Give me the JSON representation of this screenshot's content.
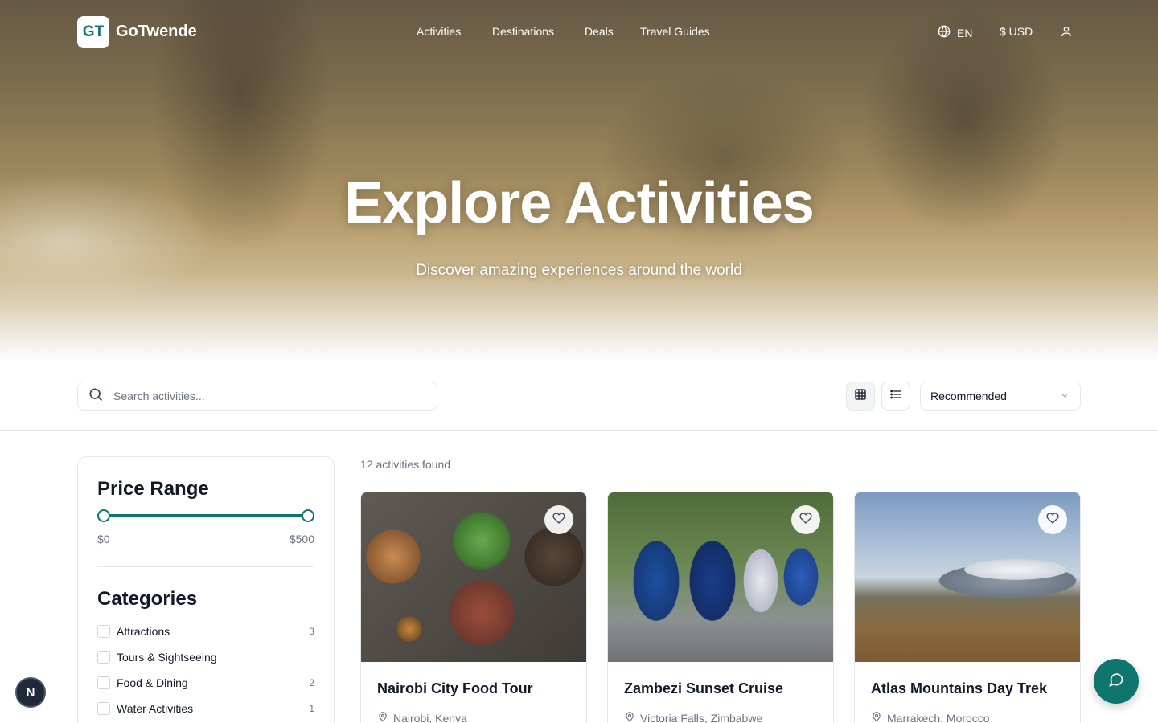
{
  "brand": {
    "logo_initials": "GT",
    "name": "GoTwende"
  },
  "nav": {
    "links": [
      "Activities",
      "Destinations",
      "Deals",
      "Travel Guides"
    ],
    "language": "EN",
    "currency": "$ USD"
  },
  "hero": {
    "title": "Explore Activities",
    "subtitle": "Discover amazing experiences around the world"
  },
  "toolbar": {
    "search_placeholder": "Search activities...",
    "sort_value": "Recommended"
  },
  "filters": {
    "price_heading": "Price Range",
    "price_min": "$0",
    "price_max": "$500",
    "categories_heading": "Categories",
    "categories": [
      {
        "label": "Attractions",
        "count": "3"
      },
      {
        "label": "Tours & Sightseeing",
        "count": ""
      },
      {
        "label": "Food & Dining",
        "count": "2"
      },
      {
        "label": "Water Activities",
        "count": "1"
      }
    ]
  },
  "results": {
    "count_text": "12 activities found",
    "cards": [
      {
        "title": "Nairobi City Food Tour",
        "location": "Nairobi, Kenya"
      },
      {
        "title": "Zambezi Sunset Cruise",
        "location": "Victoria Falls, Zimbabwe"
      },
      {
        "title": "Atlas Mountains Day Trek",
        "location": "Marrakech, Morocco"
      }
    ]
  },
  "floating": {
    "left_badge": "N"
  },
  "colors": {
    "accent": "#0f766e"
  },
  "icons": [
    "globe-icon",
    "user-icon",
    "search-icon",
    "grid-view-icon",
    "list-view-icon",
    "chevron-down-icon",
    "heart-icon",
    "map-pin-icon",
    "chat-icon"
  ]
}
